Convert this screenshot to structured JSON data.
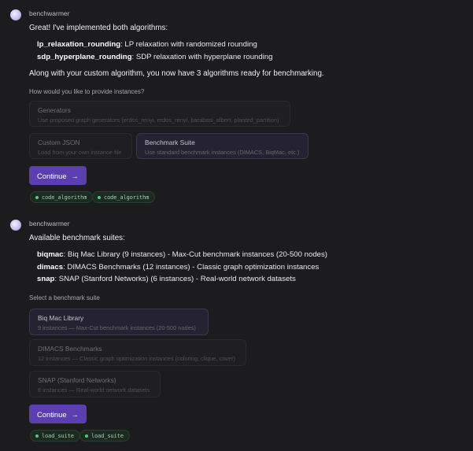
{
  "msg1": {
    "author": "benchwarmer",
    "intro": "Great! I've implemented both algorithms:",
    "algorithms": [
      {
        "name": "lp_relaxation_rounding",
        "desc": ": LP relaxation with randomized rounding"
      },
      {
        "name": "sdp_hyperplane_rounding",
        "desc": ": SDP relaxation with hyperplane rounding"
      }
    ],
    "summary": "Along with your custom algorithm, you now have 3 algorithms ready for benchmarking.",
    "question": "How would you like to provide instances?",
    "options": [
      {
        "title": "Generators",
        "desc": "Use proposed graph generators (erdos_renyi, erdos_renyi, barabasi_albert, planted_partition)"
      },
      {
        "title": "Custom JSON",
        "desc": "Load from your own instance file"
      },
      {
        "title": "Benchmark Suite",
        "desc": "Use standard benchmark instances (DIMACS, BiqMac, etc.)"
      }
    ],
    "continue_label": "Continue",
    "tags": [
      "code_algorithm",
      "code_algorithm"
    ]
  },
  "msg2": {
    "author": "benchwarmer",
    "intro": "Available benchmark suites:",
    "suites": [
      {
        "name": "biqmac",
        "desc": ": Biq Mac Library (9 instances) - Max-Cut benchmark instances (20-500 nodes)"
      },
      {
        "name": "dimacs",
        "desc": ": DIMACS Benchmarks (12 instances) - Classic graph optimization instances"
      },
      {
        "name": "snap",
        "desc": ": SNAP (Stanford Networks) (6 instances) - Real-world network datasets"
      }
    ],
    "question": "Select a benchmark suite",
    "options": [
      {
        "title": "Biq Mac Library",
        "desc": "9 instances — Max-Cut benchmark instances (20-500 nodes)"
      },
      {
        "title": "DIMACS Benchmarks",
        "desc": "12 instances — Classic graph optimization instances (coloring, clique, cover)"
      },
      {
        "title": "SNAP (Stanford Networks)",
        "desc": "6 instances — Real-world network datasets"
      }
    ],
    "continue_label": "Continue",
    "tags": [
      "load_suite",
      "load_suite"
    ]
  },
  "icons": {
    "continue_arrow": "→"
  }
}
